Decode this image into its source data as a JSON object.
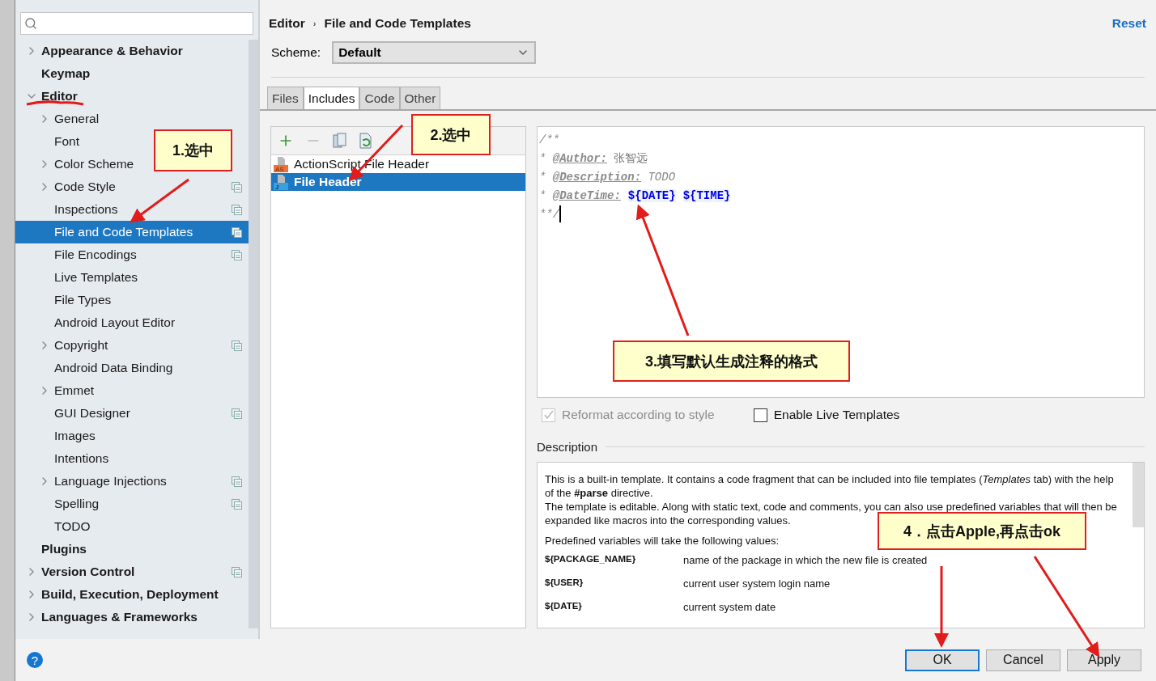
{
  "sidebar": {
    "items": [
      {
        "label": "Appearance & Behavior",
        "bold": true,
        "expanded": false,
        "selected": false,
        "project": false
      },
      {
        "label": "Keymap",
        "bold": true,
        "selected": false,
        "project": false
      },
      {
        "label": "Editor",
        "bold": true,
        "expanded": true,
        "selected": false,
        "project": false,
        "children": [
          {
            "label": "General",
            "expanded": false,
            "selected": false,
            "project": false
          },
          {
            "label": "Font",
            "selected": false,
            "project": false
          },
          {
            "label": "Color Scheme",
            "expanded": false,
            "selected": false,
            "project": false
          },
          {
            "label": "Code Style",
            "expanded": false,
            "selected": false,
            "project": true
          },
          {
            "label": "Inspections",
            "selected": false,
            "project": true
          },
          {
            "label": "File and Code Templates",
            "selected": true,
            "project": true
          },
          {
            "label": "File Encodings",
            "selected": false,
            "project": true
          },
          {
            "label": "Live Templates",
            "selected": false,
            "project": false
          },
          {
            "label": "File Types",
            "selected": false,
            "project": false
          },
          {
            "label": "Android Layout Editor",
            "selected": false,
            "project": false
          },
          {
            "label": "Copyright",
            "expanded": false,
            "selected": false,
            "project": true
          },
          {
            "label": "Android Data Binding",
            "selected": false,
            "project": false
          },
          {
            "label": "Emmet",
            "expanded": false,
            "selected": false,
            "project": false
          },
          {
            "label": "GUI Designer",
            "selected": false,
            "project": true
          },
          {
            "label": "Images",
            "selected": false,
            "project": false
          },
          {
            "label": "Intentions",
            "selected": false,
            "project": false
          },
          {
            "label": "Language Injections",
            "expanded": false,
            "selected": false,
            "project": true
          },
          {
            "label": "Spelling",
            "selected": false,
            "project": true
          },
          {
            "label": "TODO",
            "selected": false,
            "project": false
          }
        ]
      },
      {
        "label": "Plugins",
        "bold": true,
        "selected": false,
        "project": false
      },
      {
        "label": "Version Control",
        "bold": true,
        "expanded": false,
        "selected": false,
        "project": true
      },
      {
        "label": "Build, Execution, Deployment",
        "bold": true,
        "expanded": false,
        "selected": false,
        "project": false
      },
      {
        "label": "Languages & Frameworks",
        "bold": true,
        "expanded": false,
        "selected": false,
        "project": false
      }
    ]
  },
  "breadcrumb": [
    "Editor",
    "File and Code Templates"
  ],
  "breadcrumb_separator": "›",
  "reset": "Reset",
  "scheme": {
    "label": "Scheme:",
    "value": "Default"
  },
  "tabs": [
    {
      "label": "Files",
      "selected": false
    },
    {
      "label": "Includes",
      "selected": true
    },
    {
      "label": "Code",
      "selected": false
    },
    {
      "label": "Other",
      "selected": false
    }
  ],
  "templates": [
    {
      "name": "ActionScript File Header",
      "kind": "as",
      "selected": false
    },
    {
      "name": "File Header",
      "kind": "java",
      "selected": true
    }
  ],
  "template_icon_labels": {
    "as": "AS",
    "java": "J"
  },
  "code": [
    [
      {
        "kind": "comment",
        "text": "/**"
      }
    ],
    [
      {
        "kind": "comment",
        "text": "* "
      },
      {
        "kind": "tag",
        "text": "@Author:"
      },
      {
        "kind": "plain",
        "text": " 张智远"
      }
    ],
    [
      {
        "kind": "comment",
        "text": "* "
      },
      {
        "kind": "tag",
        "text": "@Description:"
      },
      {
        "kind": "comment",
        "text": " TODO"
      }
    ],
    [
      {
        "kind": "comment",
        "text": "* "
      },
      {
        "kind": "tag",
        "text": "@DateTime:"
      },
      {
        "kind": "var",
        "text": "${DATE}"
      },
      {
        "kind": "var",
        "text": "${TIME}"
      }
    ],
    [
      {
        "kind": "comment",
        "text": "**/"
      },
      {
        "kind": "cursor"
      }
    ]
  ],
  "options": [
    {
      "label": "Reformat according to style",
      "checked": true,
      "disabled": true
    },
    {
      "label": "Enable Live Templates",
      "checked": false,
      "disabled": false
    }
  ],
  "description": {
    "title": "Description",
    "paragraphs": [
      "This is a built-in template. It contains a code fragment that can be included into file templates (*Templates* tab) with the help of the **#parse** directive.\nThe template is editable. Along with static text, code and comments, you can also use predefined variables that will then be expanded like macros into the corresponding values.",
      "Predefined variables will take the following values:"
    ],
    "variables": [
      {
        "name": "${PACKAGE_NAME}",
        "meaning": "name of the package in which the new file is created"
      },
      {
        "name": "${USER}",
        "meaning": "current user system login name"
      },
      {
        "name": "${DATE}",
        "meaning": "current system date"
      }
    ]
  },
  "help": "?",
  "buttons": [
    {
      "label": "OK",
      "default": true
    },
    {
      "label": "Cancel",
      "default": false
    },
    {
      "label": "Apply",
      "default": false
    }
  ],
  "callouts": [
    "1.选中",
    "2.选中",
    "3.填写默认生成注释的格式",
    "4．点击Apple,再点击ok"
  ]
}
